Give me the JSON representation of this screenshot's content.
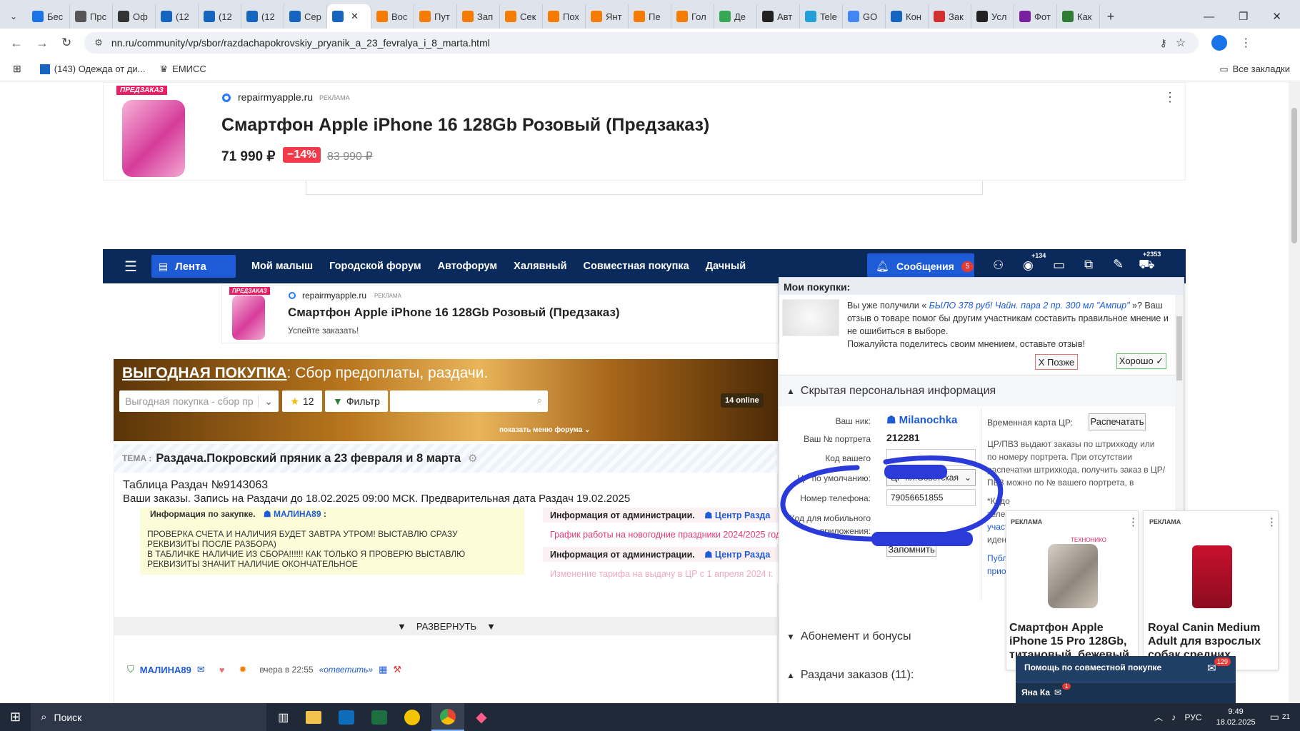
{
  "tabs": [
    {
      "label": "Бес",
      "color": "#1a73e8"
    },
    {
      "label": "Прс",
      "color": "#555"
    },
    {
      "label": "Оф",
      "color": "#333"
    },
    {
      "label": "(12",
      "color": "#1565c0"
    },
    {
      "label": "(12",
      "color": "#1565c0"
    },
    {
      "label": "(12",
      "color": "#1565c0"
    },
    {
      "label": "Сер",
      "color": "#1565c0"
    },
    {
      "label": "",
      "color": "#1565c0"
    },
    {
      "label": "Вос",
      "color": "#f57c00"
    },
    {
      "label": "Пут",
      "color": "#f57c00"
    },
    {
      "label": "Зап",
      "color": "#f57c00"
    },
    {
      "label": "Сек",
      "color": "#f57c00"
    },
    {
      "label": "Пох",
      "color": "#f57c00"
    },
    {
      "label": "Янт",
      "color": "#f57c00"
    },
    {
      "label": "Пе",
      "color": "#f57c00"
    },
    {
      "label": "Гол",
      "color": "#f57c00"
    },
    {
      "label": "Де",
      "color": "#34a853"
    },
    {
      "label": "Авт",
      "color": "#222"
    },
    {
      "label": "Tele",
      "color": "#229ed9"
    },
    {
      "label": "GO",
      "color": "#4285f4"
    },
    {
      "label": "Кон",
      "color": "#1565c0"
    },
    {
      "label": "Зак",
      "color": "#d32f2f"
    },
    {
      "label": "Усл",
      "color": "#222"
    },
    {
      "label": "Фот",
      "color": "#7b1fa2"
    },
    {
      "label": "Как",
      "color": "#2e7d32"
    }
  ],
  "active_tab_index": 7,
  "url": "nn.ru/community/vp/sbor/razdachapokrovskiy_pryanik_a_23_fevralya_i_8_marta.html",
  "bookmarks": {
    "item1": "(143) Одежда от ди...",
    "item2": "ЕМИСС",
    "all": "Все закладки"
  },
  "top_ad": {
    "badge": "ПРЕДЗАКАЗ",
    "domain": "repairmyapple.ru",
    "ad": "РЕКЛАМА",
    "title": "Смартфон Apple iPhone 16 128Gb Розовый (Предзаказ)",
    "price": "71 990 ₽",
    "discount": "−14%",
    "old_price": "83 990 ₽"
  },
  "nav": {
    "feed": "Лента",
    "links": [
      "Мой малыш",
      "Городской форум",
      "Автофорум",
      "Халявный",
      "Совместная покупка",
      "Дачный"
    ],
    "messages": "Сообщения",
    "messages_count": "5",
    "views": "+134",
    "cart": "+2353"
  },
  "ad2": {
    "badge": "ПРЕДЗАКАЗ",
    "domain": "repairmyapple.ru",
    "ad": "РЕКЛАМА",
    "title": "Смартфон Apple iPhone 16 128Gb Розовый (Предзаказ)",
    "sub": "Успейте заказать!"
  },
  "forum": {
    "title": "ВЫГОДНАЯ ПОКУПКА",
    "title_rest": ": Сбор предоплаты, раздачи.",
    "select": "Выгодная покупка - сбор пр",
    "stars": "12",
    "filter": "Фильтр",
    "online": "14 online",
    "menu": "показать меню форума"
  },
  "topic": {
    "label": "ТЕМА :",
    "title": "Раздача.Покровский пряник а 23 февраля и 8 марта"
  },
  "table": {
    "title": "Таблица Раздач №9143063",
    "sub": "Ваши заказы. Запись на Раздачи до 18.02.2025 09:00 МСК. Предварительная дата Раздач 19.02.2025"
  },
  "info": {
    "label": "Информация по закупке.",
    "user": "МАЛИНА89",
    "colon": ":",
    "text1": "ПРОВЕРКА СЧЕТА И НАЛИЧИЯ БУДЕТ ЗАВТРА УТРОМ! ВЫСТАВЛЮ СРАЗУ",
    "text2": "РЕКВИЗИТЫ ПОСЛЕ РАЗБОРА)",
    "text3": "В ТАБЛИЧКЕ НАЛИЧИЕ ИЗ СБОРА!!!!!! КАК ТОЛЬКО Я ПРОВЕРЮ ВЫСТАВЛЮ",
    "text4": "РЕКВИЗИТЫ ЗНАЧИТ НАЛИЧИЕ ОКОНЧАТЕЛЬНОЕ"
  },
  "admin": {
    "label": "Информация от администрации.",
    "who": "Центр Разда",
    "link1": "График работы на новогодние праздники 2024/2025 год",
    "link2": "Изменение тарифа на выдачу в ЦР с 1 апреля 2024 г.",
    "expand": "РАЗВЕРНУТЬ"
  },
  "post": {
    "user": "МАЛИНА89",
    "time": "вчера в 22:55",
    "reply": "«ответить»"
  },
  "panel": {
    "title": "Мои покупки:",
    "review_pre": "Вы уже получили « ",
    "review_link": "БЫЛО 378 руб! Чайн. пара 2 пр. 300 мл \"Ампир\"",
    "review_post": " »? Ваш",
    "review2": "отзыв о товаре помог бы другим участникам составить правильное мнение и",
    "review3": "не ошибиться в выборе.",
    "review4": "Пожалуйста поделитесь своим мнением, оставьте отзыв!",
    "later": "Х Позже",
    "ok": "Хорошо ✓",
    "hidden": "Скрытая персональная информация",
    "nick_label": "Ваш ник:",
    "nick": "Milanochka",
    "portrait_label": "Ваш № портрета",
    "portrait": "212281",
    "code_label": "Код вашего",
    "cr_label": "ЦР по умолчанию:",
    "cr_value": "ЦР пл.Советская",
    "phone_label": "Номер телефона:",
    "phone": "79056651855",
    "mobile_label1": "Код для мобильного",
    "mobile_label2": "приложения:",
    "save": "Запомнить",
    "tmp_card": "Временная карта ЦР:",
    "print": "Распечатать",
    "cr_info1": "ЦР/ПВЗ выдают заказы по штрихкоду или",
    "cr_info2": "по номеру портрета. При отсутствии",
    "cr_info3": "распечатки штрихкода, получить заказ в ЦР/",
    "cr_info4": "ПВЗ можно по № вашего портрета, в",
    "cr_info5": "*Кодо",
    "cr_info6": "телеф",
    "cr_info7": "участ",
    "cr_info8": "идент",
    "publ1": "Публ",
    "publ2": "приоб",
    "subscription": "Абонемент и бонусы",
    "orders": "Раздачи заказов (11):"
  },
  "ads": [
    {
      "label": "РЕКЛАМА",
      "brand": "ТЕХНОНИКО",
      "title1": "Смартфон Apple",
      "title2": "iPhone 15 Pro 128Gb,",
      "title3": "титановый, бежевый"
    },
    {
      "label": "РЕКЛАМА",
      "title1": "Royal Canin Medium",
      "title2": "Adult для взрослых",
      "title3": "собак средних"
    }
  ],
  "help": {
    "title": "Помощь по совместной покупке",
    "count": "129",
    "user": "Яна Ка",
    "user_count": "1"
  },
  "taskbar": {
    "search": "Поиск",
    "lang": "РУС",
    "time": "9:49",
    "date": "18.02.2025",
    "notif": "21"
  }
}
